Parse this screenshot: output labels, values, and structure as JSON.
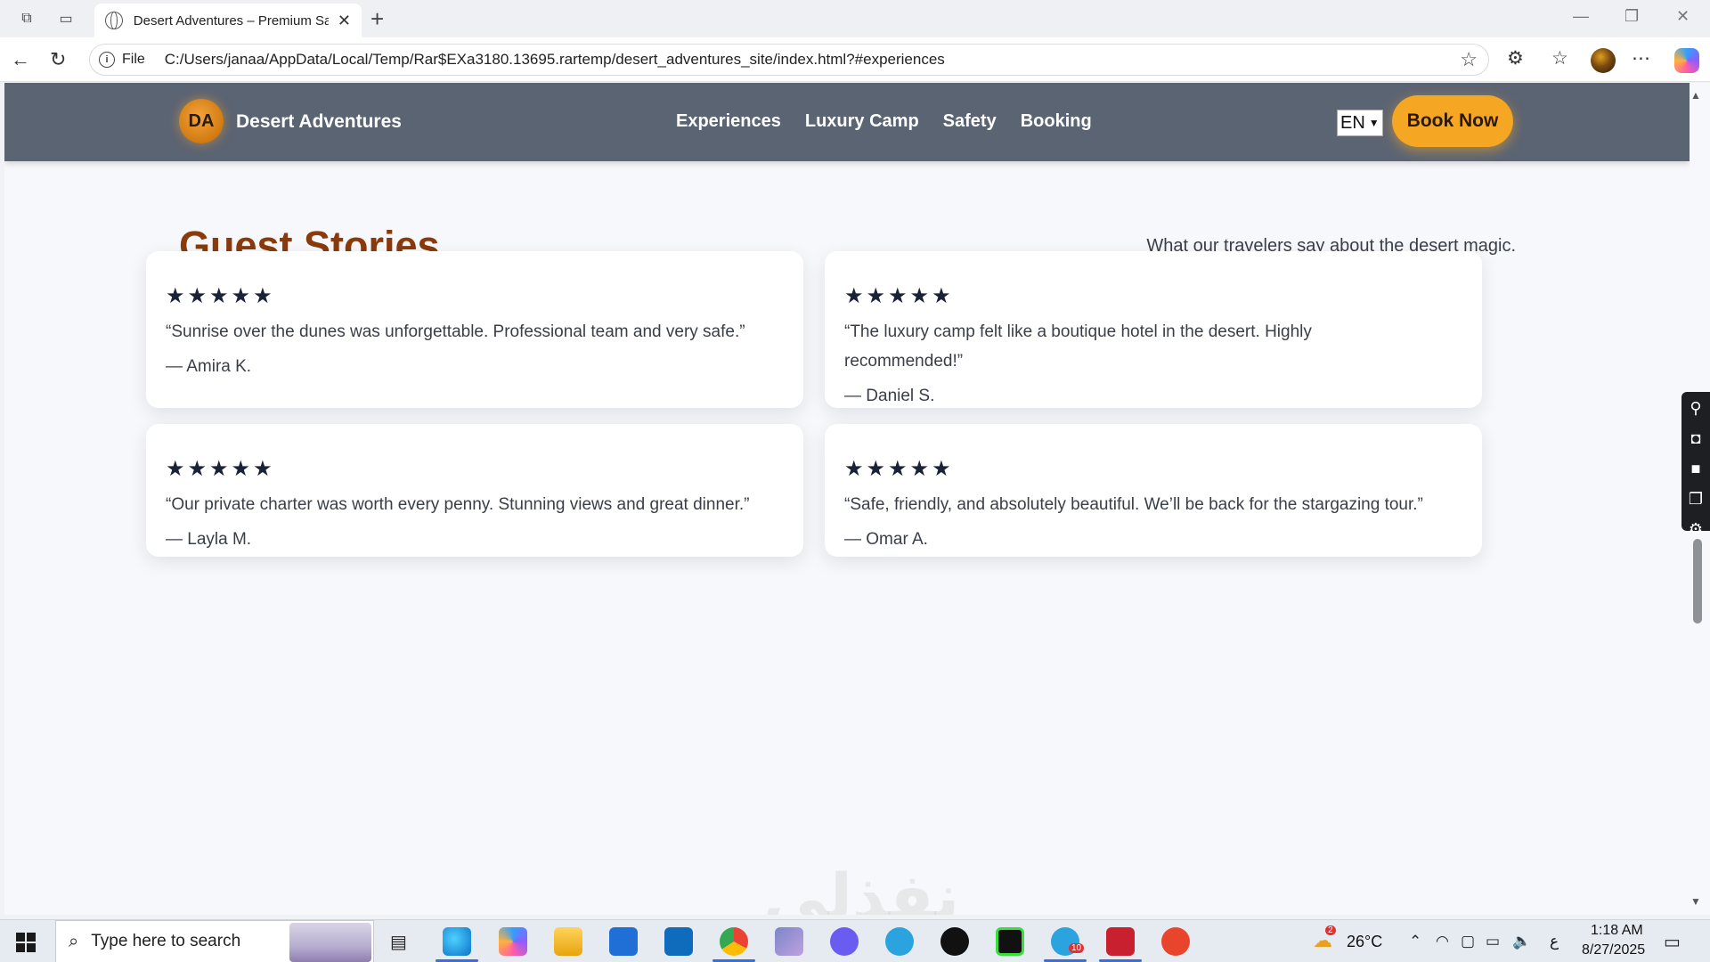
{
  "browser": {
    "tab_title": "Desert Adventures – Premium Safari",
    "file_label": "File",
    "url": "C:/Users/janaa/AppData/Local/Temp/Rar$EXa3180.13695.rartemp/desert_adventures_site/index.html?#experiences"
  },
  "site": {
    "logo_initials": "DA",
    "brand": "Desert Adventures",
    "nav": [
      "Experiences",
      "Luxury Camp",
      "Safety",
      "Booking"
    ],
    "language": "EN",
    "cta": "Book Now"
  },
  "section": {
    "title": "Guest Stories",
    "subtitle": "What our travelers say about the desert magic."
  },
  "reviews": [
    {
      "stars": "★★★★★",
      "rating": 5,
      "quote": "“Sunrise over the dunes was unforgettable. Professional team and very safe.”",
      "author": "— Amira K."
    },
    {
      "stars": "★★★★★",
      "rating": 5,
      "quote": "“The luxury camp felt like a boutique hotel in the desert. Highly recommended!”",
      "author": "— Daniel S."
    },
    {
      "stars": "★★★★★",
      "rating": 5,
      "quote": "“Our private charter was worth every penny. Stunning views and great dinner.”",
      "author": "— Layla M."
    },
    {
      "stars": "★★★★★",
      "rating": 5,
      "quote": "“Safe, friendly, and absolutely beautiful. We’ll be back for the stargazing tour.”",
      "author": "— Omar A."
    }
  ],
  "watermark": "نفذلي",
  "taskbar": {
    "search_placeholder": "Type here to search",
    "weather_badge": "2",
    "temperature": "26°C",
    "lang_indicator": "ع",
    "time": "1:18 AM",
    "date": "8/27/2025",
    "telegram_badge": "10"
  },
  "colors": {
    "header_bg": "#5b6473",
    "accent": "#f5a623",
    "title": "#8a3a0c",
    "page_bg": "#f7f8fb"
  }
}
